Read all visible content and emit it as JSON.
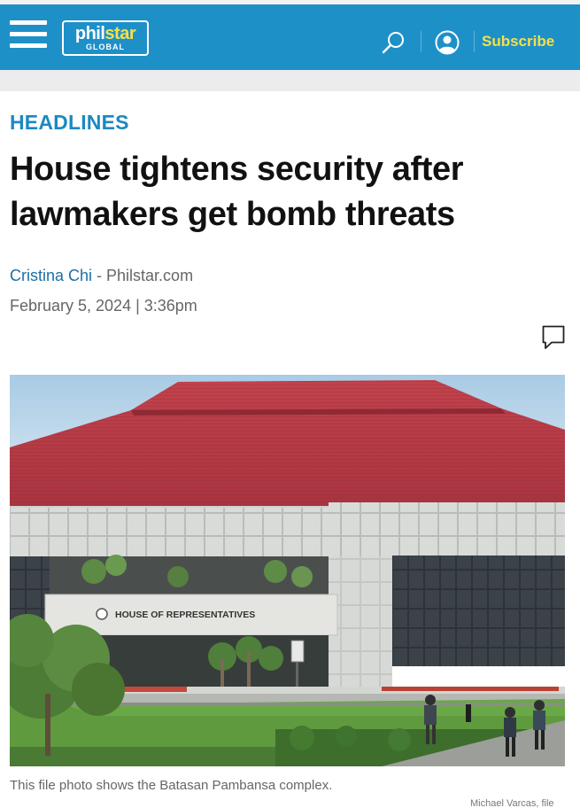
{
  "header": {
    "logo_main_a": "phil",
    "logo_main_b": "star",
    "logo_sub": "GLOBAL",
    "subscribe_label": "Subscribe",
    "accent_color": "#1e90c8",
    "subscribe_color": "#f5e04a"
  },
  "article": {
    "section": "HEADLINES",
    "title": "House tightens security after lawmakers get bomb threats",
    "author": "Cristina Chi",
    "byline_sep": " - ",
    "source": "Philstar.com",
    "date": "February 5, 2024 | 3:36pm"
  },
  "photo": {
    "sign_text": "HOUSE OF REPRESENTATIVES",
    "caption": "This file photo shows the Batasan Pambansa complex.",
    "credit": "Michael Varcas, file"
  },
  "icons": {
    "menu": "hamburger-menu-icon",
    "search": "search-icon",
    "account": "user-account-icon",
    "comment": "comment-bubble-icon"
  }
}
